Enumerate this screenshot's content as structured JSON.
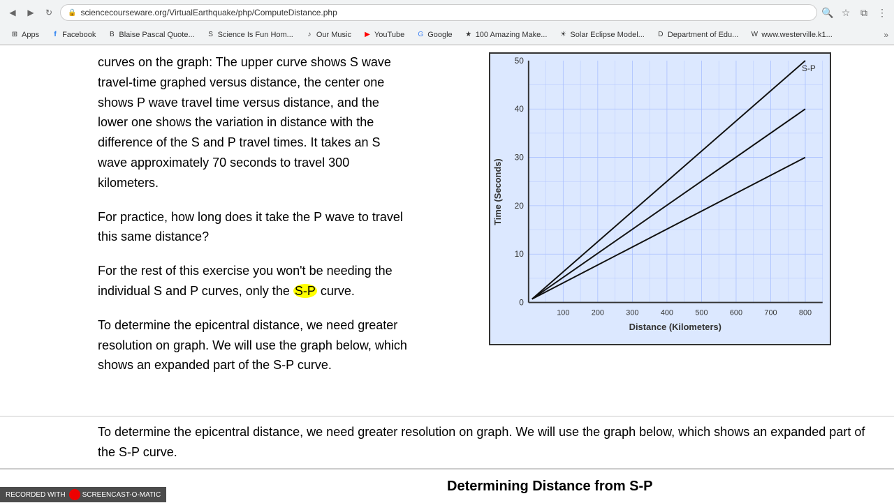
{
  "browser": {
    "url": "sciencecourseware.org/VirtualEarthquake/php/ComputeDistance.php",
    "back_btn": "◀",
    "forward_btn": "▶",
    "reload_btn": "↻"
  },
  "bookmarks": [
    {
      "label": "Apps",
      "favicon": "⊞"
    },
    {
      "label": "Facebook",
      "favicon": "f"
    },
    {
      "label": "Blaise Pascal Quote...",
      "favicon": "B"
    },
    {
      "label": "Science Is Fun Hom...",
      "favicon": "S"
    },
    {
      "label": "Our Music",
      "favicon": "♪"
    },
    {
      "label": "YouTube",
      "favicon": "▶"
    },
    {
      "label": "Google",
      "favicon": "G"
    },
    {
      "label": "100 Amazing Make...",
      "favicon": "★"
    },
    {
      "label": "Solar Eclipse Model...",
      "favicon": "☀"
    },
    {
      "label": "Department of Edu...",
      "favicon": "D"
    },
    {
      "label": "www.westerville.k1...",
      "favicon": "W"
    }
  ],
  "content": {
    "paragraph1": "curves on the graph: The upper curve shows S wave travel-time graphed versus distance, the center one shows P wave travel time versus distance, and the lower one shows the variation in distance with the difference of the S and P travel times. It takes an S wave approximately 70 seconds to travel 300 kilometers.",
    "paragraph2": "For practice, how long does it take the P wave to travel this same distance?",
    "paragraph3_before": "For the rest of this exercise you won't be needing the individual S and P curves, only the ",
    "paragraph3_highlight": "S-P",
    "paragraph3_after": " curve.",
    "paragraph4": "To determine the epicentral distance, we need greater resolution on graph. We will use the graph below, which shows an expanded part of the S-P curve.",
    "bottom_heading": "Determining Distance from S-P",
    "graph": {
      "title_y": "Time (Seconds)",
      "title_x": "Distance (Kilometers)",
      "y_labels": [
        "10",
        "20",
        "30",
        "40",
        "50"
      ],
      "x_labels": [
        "100",
        "200",
        "300",
        "400",
        "500",
        "600",
        "700",
        "800"
      ],
      "label_sp": "S-P"
    }
  },
  "watermark": {
    "text": "RECORDED WITH",
    "brand": "SCREENCAST-O-MATIC"
  }
}
